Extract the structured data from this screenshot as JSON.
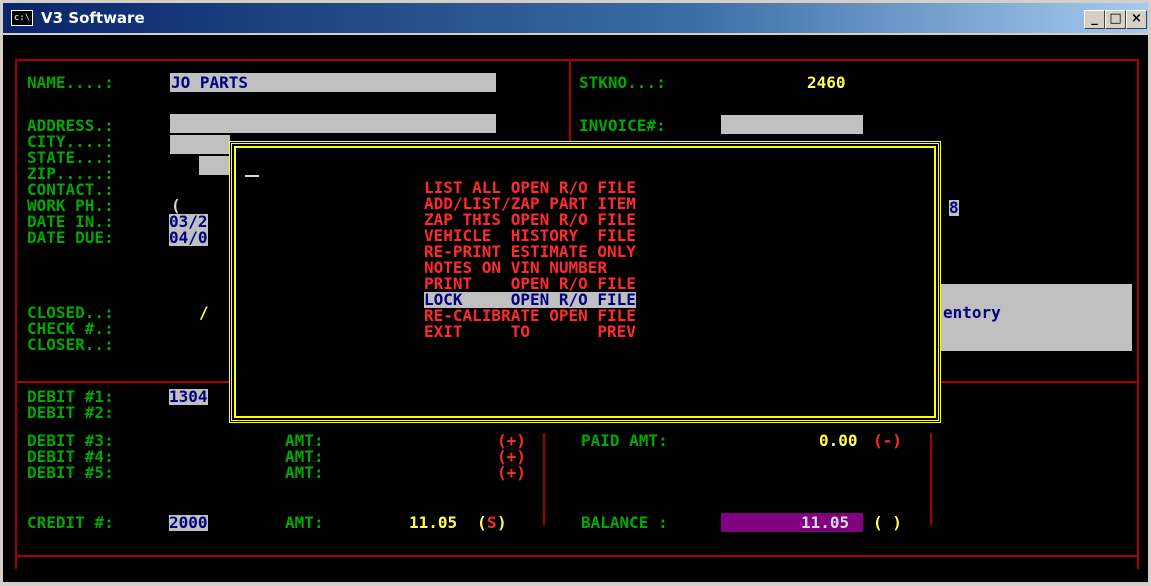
{
  "window": {
    "title": "V3 Software",
    "icon": "console-icon",
    "icon_text": "c:\\",
    "minimize": "_",
    "maximize": "□",
    "close": "×"
  },
  "form": {
    "name_label": "NAME....:",
    "name_value": "JO PARTS",
    "address_label": "ADDRESS.:",
    "city_label": "CITY....:",
    "state_label": "STATE...:",
    "zip_label": "ZIP.....:",
    "contact_label": "CONTACT.:",
    "workph_label": "WORK PH.:",
    "workph_value": "(",
    "datein_label": "DATE IN.:",
    "datein_value": "03/2",
    "datedue_label": "DATE DUE:",
    "datedue_value": "04/0",
    "closed_label": "CLOSED..:",
    "closed_value": "/",
    "check_label": "CHECK #.:",
    "closer_label": "CLOSER..:",
    "stkno_label": "STKNO...:",
    "stkno_value": "2460",
    "invoice_label": "INVOICE#:",
    "right_partial_value": "8",
    "inventory_partial": "entory"
  },
  "debits": [
    {
      "label": "DEBIT #1:",
      "value": "1304"
    },
    {
      "label": "DEBIT #2:"
    },
    {
      "label": "DEBIT #3:",
      "amt_label": "AMT:",
      "sign": "(+)"
    },
    {
      "label": "DEBIT #4:",
      "amt_label": "AMT:",
      "sign": "(+)"
    },
    {
      "label": "DEBIT #5:",
      "amt_label": "AMT:",
      "sign": "(+)"
    }
  ],
  "credit": {
    "label": "CREDIT #:",
    "value": "2000",
    "amt_label": "AMT:",
    "amt_value": "11.05",
    "sign_open": "(",
    "sign_s": "S",
    "sign_close": ")"
  },
  "paid": {
    "label": "PAID AMT:",
    "value": "0.00",
    "sign": "(-)"
  },
  "balance": {
    "label": "BALANCE :",
    "value": "11.05",
    "sign": "( )"
  },
  "menu": {
    "items": [
      "LIST ALL OPEN R/O FILE",
      "ADD/LIST/ZAP PART ITEM",
      "ZAP THIS OPEN R/O FILE",
      "VEHICLE  HISTORY  FILE",
      "RE-PRINT ESTIMATE ONLY",
      "NOTES ON VIN NUMBER",
      "PRINT    OPEN R/O FILE",
      "LOCK     OPEN R/O FILE",
      "RE-CALIBRATE OPEN FILE",
      "EXIT     TO       PREV"
    ],
    "selected_index": 7
  },
  "colors": {
    "label_green": "#00a800",
    "value_yellow": "#ffff55",
    "menu_red": "#ff2b2b",
    "frame_red": "#a80000",
    "menu_border": "#ffff00",
    "balance_bg": "#800080"
  }
}
